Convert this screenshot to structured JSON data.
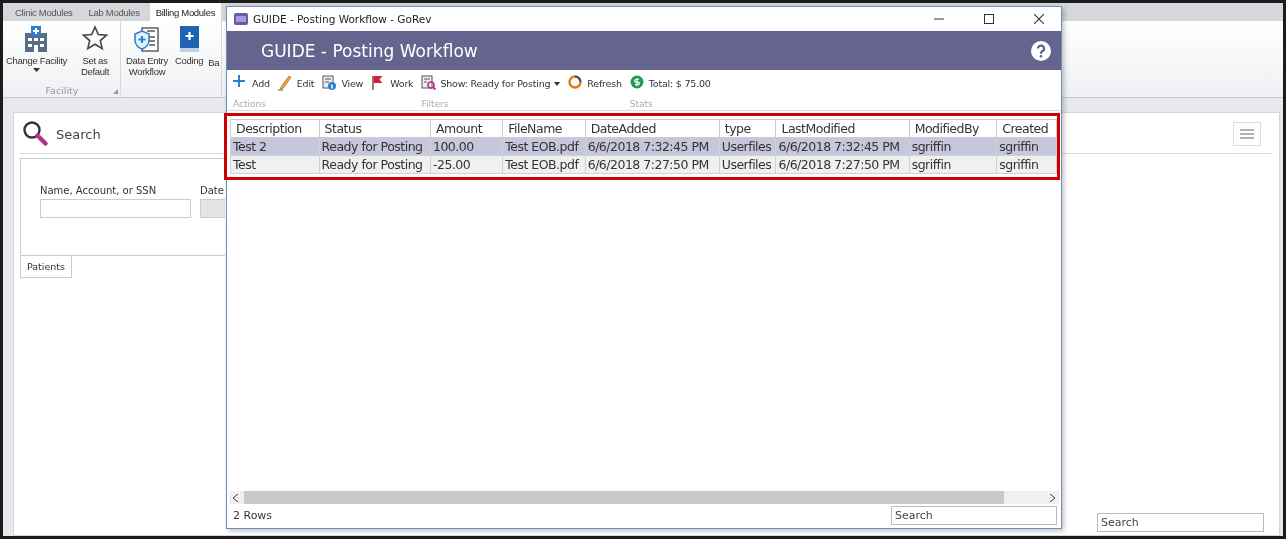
{
  "app": {
    "ribbon_tabs": [
      {
        "label": "Clinic Modules",
        "selected": false
      },
      {
        "label": "Lab Modules",
        "selected": false
      },
      {
        "label": "Billing Modules",
        "selected": true
      }
    ],
    "ribbon_groups": [
      {
        "label": "Facility",
        "items": [
          {
            "label": "Change Facility",
            "kind": "building",
            "has_menu": true
          },
          {
            "label": "Set as Default",
            "kind": "star",
            "has_menu": false
          }
        ]
      },
      {
        "items": [
          {
            "label": "Data Entry Workflow",
            "kind": "clipboard",
            "has_menu": false
          },
          {
            "label": "Coding",
            "kind": "book",
            "has_menu": false
          },
          {
            "label": "Ba",
            "kind": "cut",
            "has_menu": false
          }
        ]
      }
    ],
    "search_panel": {
      "title": "Search",
      "fields": [
        {
          "label": "Name, Account, or SSN",
          "disabled": false
        },
        {
          "label": "Date",
          "disabled": true
        }
      ],
      "tabs": [
        {
          "label": "Patients",
          "selected": true
        }
      ],
      "search_box": {
        "placeholder": "Search"
      }
    }
  },
  "dialog": {
    "window_title": "GUIDE - Posting Workflow - GoRev",
    "header": "GUIDE - Posting Workflow",
    "toolbar_groups": [
      {
        "label": "Actions",
        "buttons": [
          {
            "label": "Add",
            "kind": "add"
          },
          {
            "label": "Edit",
            "kind": "edit"
          },
          {
            "label": "View",
            "kind": "view"
          },
          {
            "label": "Work",
            "kind": "flag"
          }
        ]
      },
      {
        "label": "Filters",
        "buttons": [
          {
            "label": "Show: Ready for Posting",
            "kind": "filter",
            "has_menu": true
          },
          {
            "label": "Refresh",
            "kind": "refresh"
          }
        ]
      },
      {
        "label": "Stats",
        "buttons": [
          {
            "label": "Total: $ 75.00",
            "kind": "money"
          }
        ]
      }
    ],
    "table": {
      "columns": [
        "Description",
        "Status",
        "Amount",
        "FileName",
        "DateAdded",
        "type",
        "LastModified",
        "ModifiedBy",
        "Created"
      ],
      "rows": [
        {
          "selected": true,
          "cells": [
            "Test 2",
            "Ready for Posting",
            "100.00",
            "Test EOB.pdf",
            "6/6/2018 7:32:45 PM",
            "Userfiles",
            "6/6/2018 7:32:45 PM",
            "sgriffin",
            "sgriffin"
          ]
        },
        {
          "selected": false,
          "cells": [
            "Test",
            "Ready for Posting",
            "-25.00",
            "Test EOB.pdf",
            "6/6/2018 7:27:50 PM",
            "Userfiles",
            "6/6/2018 7:27:50 PM",
            "sgriffin",
            "sgriffin"
          ]
        }
      ]
    },
    "status_bar": {
      "row_count": "2 Rows",
      "search": {
        "placeholder": "Search"
      }
    }
  }
}
